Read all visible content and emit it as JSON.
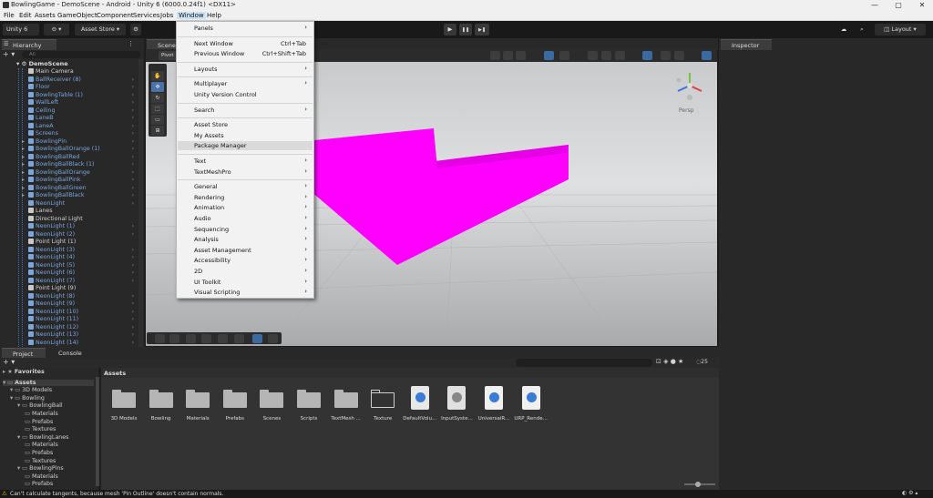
{
  "window": {
    "title": "BowlingGame - DemoScene - Android - Unity 6 (6000.0.24f1) <DX11>",
    "minimize": "—",
    "maximize": "▢",
    "close": "✕"
  },
  "menubar": [
    "File",
    "Edit",
    "Assets",
    "GameObject",
    "Component",
    "Services",
    "Jobs",
    "Window",
    "Help"
  ],
  "toolbar": {
    "account": "Unity 6",
    "asset_store": "Asset Store ▾",
    "layout": "Layout",
    "play": "▶",
    "pause": "❚❚",
    "step": "▶❚"
  },
  "hierarchy": {
    "tab": "Hierarchy",
    "search_placeholder": "All",
    "scene": "DemoScene",
    "items": [
      {
        "label": "Main Camera",
        "color": "white"
      },
      {
        "label": "BallReceiver (8)",
        "color": "blue"
      },
      {
        "label": "Floor",
        "color": "blue"
      },
      {
        "label": "BowlingTable (1)",
        "color": "blue"
      },
      {
        "label": "WallLeft",
        "color": "blue"
      },
      {
        "label": "Ceiling",
        "color": "blue"
      },
      {
        "label": "LaneB",
        "color": "blue"
      },
      {
        "label": "LaneA",
        "color": "blue"
      },
      {
        "label": "Screens",
        "color": "blue"
      },
      {
        "label": "BowlingPin",
        "color": "blue"
      },
      {
        "label": "BowlingBallOrange (1)",
        "color": "blue"
      },
      {
        "label": "BowlingBallRed",
        "color": "blue"
      },
      {
        "label": "BowlingBallBlack (1)",
        "color": "blue"
      },
      {
        "label": "BowlingBallOrange",
        "color": "blue"
      },
      {
        "label": "BowlingBallPink",
        "color": "blue"
      },
      {
        "label": "BowlingBallGreen",
        "color": "blue"
      },
      {
        "label": "BowlingBallBlack",
        "color": "blue"
      },
      {
        "label": "NeonLight",
        "color": "blue"
      },
      {
        "label": "Lanes",
        "color": "white"
      },
      {
        "label": "Directional Light",
        "color": "white"
      },
      {
        "label": "NeonLight (1)",
        "color": "blue"
      },
      {
        "label": "NeonLight (2)",
        "color": "blue"
      },
      {
        "label": "Point Light (1)",
        "color": "white"
      },
      {
        "label": "NeonLight (3)",
        "color": "blue"
      },
      {
        "label": "NeonLight (4)",
        "color": "blue"
      },
      {
        "label": "NeonLight (5)",
        "color": "blue"
      },
      {
        "label": "NeonLight (6)",
        "color": "blue"
      },
      {
        "label": "NeonLight (7)",
        "color": "blue"
      },
      {
        "label": "Point Light (9)",
        "color": "white"
      },
      {
        "label": "NeonLight (8)",
        "color": "blue"
      },
      {
        "label": "NeonLight (9)",
        "color": "blue"
      },
      {
        "label": "NeonLight (10)",
        "color": "blue"
      },
      {
        "label": "NeonLight (11)",
        "color": "blue"
      },
      {
        "label": "NeonLight (12)",
        "color": "blue"
      },
      {
        "label": "NeonLight (13)",
        "color": "blue"
      },
      {
        "label": "NeonLight (14)",
        "color": "blue"
      }
    ]
  },
  "scene": {
    "tab": "Scene",
    "pivot": "Pivot",
    "persp": "Persp"
  },
  "inspector": {
    "tab": "Inspector"
  },
  "window_menu": {
    "items": [
      {
        "label": "Panels",
        "submenu": true
      },
      {
        "sep": true
      },
      {
        "label": "Next Window",
        "shortcut": "Ctrl+Tab"
      },
      {
        "label": "Previous Window",
        "shortcut": "Ctrl+Shift+Tab"
      },
      {
        "sep": true
      },
      {
        "label": "Layouts",
        "submenu": true
      },
      {
        "sep": true
      },
      {
        "label": "Multiplayer",
        "submenu": true
      },
      {
        "label": "Unity Version Control"
      },
      {
        "sep": true
      },
      {
        "label": "Search",
        "submenu": true
      },
      {
        "sep": true
      },
      {
        "label": "Asset Store"
      },
      {
        "label": "My Assets"
      },
      {
        "label": "Package Manager",
        "highlight": true
      },
      {
        "sep": true
      },
      {
        "label": "Text",
        "submenu": true
      },
      {
        "label": "TextMeshPro",
        "submenu": true
      },
      {
        "sep": true
      },
      {
        "label": "General",
        "submenu": true
      },
      {
        "label": "Rendering",
        "submenu": true
      },
      {
        "label": "Animation",
        "submenu": true
      },
      {
        "label": "Audio",
        "submenu": true
      },
      {
        "label": "Sequencing",
        "submenu": true
      },
      {
        "label": "Analysis",
        "submenu": true
      },
      {
        "label": "Asset Management",
        "submenu": true
      },
      {
        "label": "Accessibility",
        "submenu": true
      },
      {
        "label": "2D",
        "submenu": true
      },
      {
        "label": "UI Toolkit",
        "submenu": true
      },
      {
        "label": "Visual Scripting",
        "submenu": true
      }
    ]
  },
  "bottom": {
    "project_tab": "Project",
    "console_tab": "Console",
    "breadcrumb": "Assets",
    "icon_count": "25"
  },
  "project_tree": [
    {
      "label": "Favorites",
      "level": 0,
      "bold": true
    },
    {
      "label": "Assets",
      "level": 0,
      "bold": true,
      "selected": true
    },
    {
      "label": "3D Models",
      "level": 1
    },
    {
      "label": "Bowling",
      "level": 1
    },
    {
      "label": "BowlingBall",
      "level": 2
    },
    {
      "label": "Materials",
      "level": 3
    },
    {
      "label": "Prefabs",
      "level": 3
    },
    {
      "label": "Textures",
      "level": 3
    },
    {
      "label": "BowlingLanes",
      "level": 2
    },
    {
      "label": "Materials",
      "level": 3
    },
    {
      "label": "Prefabs",
      "level": 3
    },
    {
      "label": "Textures",
      "level": 3
    },
    {
      "label": "BowlingPins",
      "level": 2
    },
    {
      "label": "Materials",
      "level": 3
    },
    {
      "label": "Prefabs",
      "level": 3
    }
  ],
  "assets": [
    {
      "label": "3D Models",
      "kind": "folder"
    },
    {
      "label": "Bowling",
      "kind": "folder"
    },
    {
      "label": "Materials",
      "kind": "folder"
    },
    {
      "label": "Prefabs",
      "kind": "folder"
    },
    {
      "label": "Scenes",
      "kind": "folder"
    },
    {
      "label": "Scripts",
      "kind": "folder"
    },
    {
      "label": "TextMesh ...",
      "kind": "folder"
    },
    {
      "label": "Texture",
      "kind": "folder-outline"
    },
    {
      "label": "DefaultVolu...",
      "kind": "volume"
    },
    {
      "label": "InputSyste...",
      "kind": "input"
    },
    {
      "label": "UniversalR...",
      "kind": "urp"
    },
    {
      "label": "URP_Rende...",
      "kind": "urp2"
    }
  ],
  "status": {
    "message": "Can't calculate tangents, because mesh 'Pin Outline' doesn't contain normals."
  },
  "colors": {
    "accent": "#3b6aa0",
    "magenta": "#ff00ff",
    "hier_blue": "#7aa6dd",
    "warning": "#f0c000"
  }
}
